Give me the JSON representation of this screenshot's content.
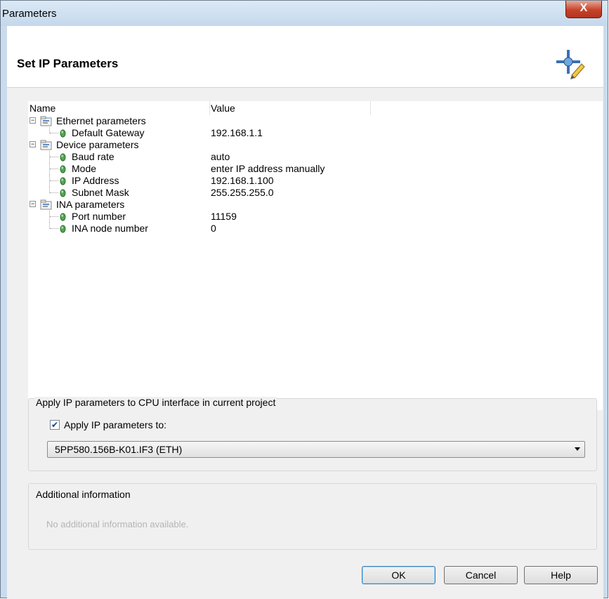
{
  "window": {
    "title": "Parameters",
    "close_label": "X"
  },
  "header": {
    "title": "Set IP Parameters",
    "icon": "wizard-wand-icon"
  },
  "tree": {
    "columns": [
      "Name",
      "Value"
    ],
    "groups": [
      {
        "label": "Ethernet parameters",
        "items": [
          {
            "name": "Default Gateway",
            "value": "192.168.1.1"
          }
        ]
      },
      {
        "label": "Device parameters",
        "items": [
          {
            "name": "Baud rate",
            "value": "auto"
          },
          {
            "name": "Mode",
            "value": "enter IP address manually"
          },
          {
            "name": "IP Address",
            "value": "192.168.1.100"
          },
          {
            "name": "Subnet Mask",
            "value": "255.255.255.0"
          }
        ]
      },
      {
        "label": "INA parameters",
        "items": [
          {
            "name": "Port number",
            "value": "11159"
          },
          {
            "name": "INA node number",
            "value": "0"
          }
        ]
      }
    ]
  },
  "apply_group": {
    "title": "Apply IP parameters to CPU interface in current project",
    "checkbox_label": "Apply IP parameters to:",
    "checkbox_checked": true,
    "selected_interface": "5PP580.156B-K01.IF3 (ETH)"
  },
  "info_group": {
    "title": "Additional information",
    "text": "No additional information available."
  },
  "buttons": {
    "ok": "OK",
    "cancel": "Cancel",
    "help": "Help"
  }
}
